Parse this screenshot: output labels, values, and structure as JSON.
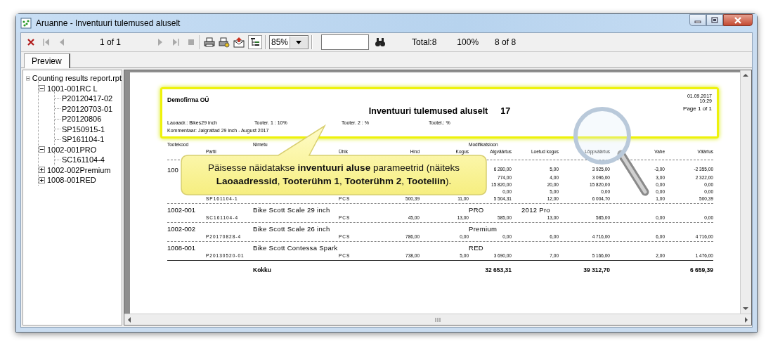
{
  "window": {
    "title": "Aruanne - Inventuuri tulemused aluselt"
  },
  "toolbar": {
    "page_indicator": "1 of 1",
    "tree_toggle": {
      "pressed": true
    },
    "zoom": "85%",
    "total": "Total:8",
    "percent": "100%",
    "count": "8 of 8"
  },
  "tabs": [
    {
      "label": "Preview",
      "selected": true
    }
  ],
  "tree": [
    {
      "label": "Counting results report.rpt",
      "expanded": true,
      "children": [
        {
          "label": "1001-001RC L",
          "expanded": true,
          "children": [
            {
              "label": "P20120417-02"
            },
            {
              "label": "P20120703-01"
            },
            {
              "label": "P20120806"
            },
            {
              "label": "SP150915-1"
            },
            {
              "label": "SP161104-1"
            }
          ]
        },
        {
          "label": "1002-001PRO",
          "expanded": true,
          "children": [
            {
              "label": "SC161104-4"
            }
          ]
        },
        {
          "label": "1002-002Premium",
          "expanded": false
        },
        {
          "label": "1008-001RED",
          "expanded": false
        }
      ]
    }
  ],
  "report": {
    "company": "Demofirma OÜ",
    "date": "01.09.2017",
    "time": "10:29",
    "title": "Inventuuri tulemused aluselt",
    "number": "17",
    "page": "Page 1 of 1",
    "params": [
      "Laoaadr.: Bikes29 inch",
      "Tooter. 1 : 10%",
      "Tooter. 2 : %",
      "Tootel.: %"
    ],
    "comment": "Kommentaar: Jalgrattad 29 inch - August 2017",
    "columns_top": [
      "Tootekood",
      "Nimetu",
      "Modifikatsioon"
    ],
    "columns": [
      "Partii",
      "Ühik",
      "Hind",
      "Kogus",
      "Algväärtus",
      "Loetud kogus",
      "Lõppväärtus",
      "Vahe",
      "Väärtus"
    ],
    "groups": [
      {
        "code": "100",
        "rows": [
          [
            null,
            null,
            null,
            null,
            "6 280,00",
            "5,00",
            "3 925,00",
            "-3,00",
            "-2 355,00"
          ],
          [
            null,
            null,
            null,
            null,
            "774,00",
            "4,00",
            "3 096,00",
            "3,00",
            "2 322,00"
          ],
          [
            null,
            null,
            null,
            null,
            "15 820,00",
            "20,00",
            "15 820,00",
            "0,00",
            "0,00"
          ],
          [
            null,
            null,
            null,
            null,
            "0,00",
            "5,00",
            "0,00",
            "0,00",
            "0,00"
          ],
          [
            "SP161104-1",
            "PCS",
            "500,39",
            "11,00",
            "5 504,31",
            "12,00",
            "6 004,70",
            "1,00",
            "500,39"
          ]
        ]
      },
      {
        "code": "1002-001",
        "name": "Bike Scott Scale 29 inch",
        "modification": [
          "PRO",
          "2012 Pro"
        ],
        "rows": [
          [
            "SC161104-4",
            "PCS",
            "45,00",
            "13,00",
            "585,00",
            "13,00",
            "585,00",
            "0,00",
            "0,00"
          ]
        ]
      },
      {
        "code": "1002-002",
        "name": "Bike Scott Scale 26 inch",
        "modification": [
          "Premium"
        ],
        "rows": [
          [
            "P20170828-4",
            "PCS",
            "786,00",
            "0,00",
            "0,00",
            "6,00",
            "4 716,00",
            "6,00",
            "4 716,00"
          ]
        ]
      },
      {
        "code": "1008-001",
        "name": "Bike Scott Contessa Spark",
        "modification": [
          "RED"
        ],
        "rows": [
          [
            "P20130520-01",
            "PCS",
            "738,00",
            "5,00",
            "3 690,00",
            "7,00",
            "5 166,00",
            "2,00",
            "1 476,00"
          ]
        ]
      }
    ],
    "total": {
      "label": "Kokku",
      "values": [
        "32 653,31",
        "39 312,70",
        "6 659,39"
      ]
    }
  },
  "callout": {
    "text": "Päisesse näidatakse **inventuuri aluse** parameetrid (näiteks **Laoaadressid**, **Tooterühm 1**, **Tooterühm 2**, **Tooteliin**)."
  }
}
